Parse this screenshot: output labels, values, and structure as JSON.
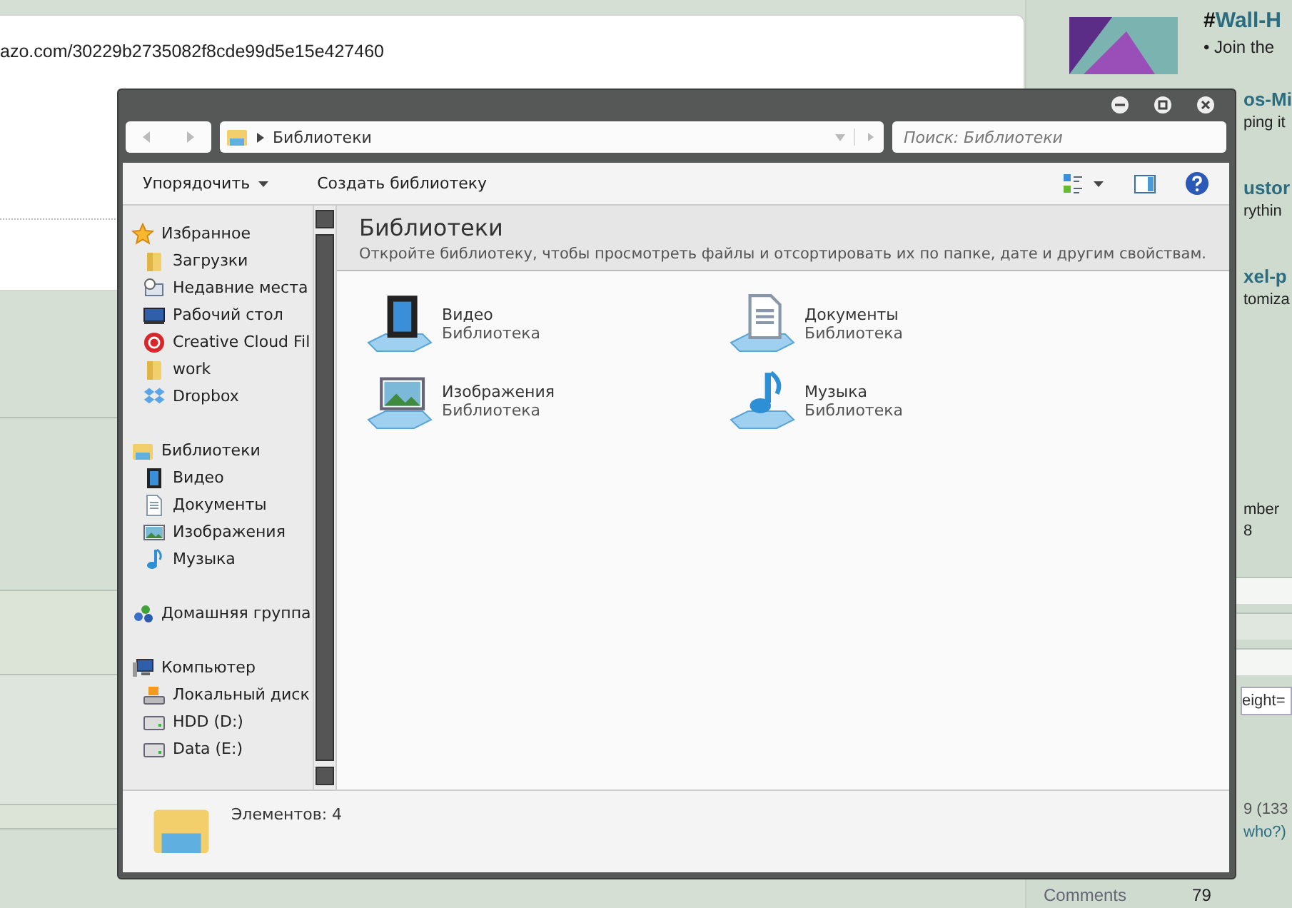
{
  "page": {
    "url_text": "azo.com/30229b2735082f8cde99d5e15e427460"
  },
  "sidebar": {
    "featured": {
      "prefix": "#",
      "title": "Wall-H",
      "text": "• Join the"
    },
    "snippets": [
      {
        "heading": "os-Mi",
        "text": "ping it"
      },
      {
        "heading": "ustor",
        "text": "rythin"
      },
      {
        "heading": "xel-p",
        "text": "tomiza"
      }
    ],
    "info": [
      "mber",
      "8"
    ],
    "field_value": "eight=",
    "stats": [
      "9 (133",
      "who?)"
    ],
    "footer": {
      "label": "Comments",
      "value": "79"
    }
  },
  "explorer": {
    "address": {
      "path": "Библиотеки"
    },
    "search": {
      "placeholder": "Поиск: Библиотеки"
    },
    "toolbar": [
      {
        "label": "Упорядочить",
        "dropdown": true
      },
      {
        "label": "Создать библиотеку",
        "dropdown": false
      }
    ],
    "nav": [
      {
        "label": "Избранное",
        "kind": "star",
        "children": [
          {
            "label": "Загрузки",
            "kind": "folder"
          },
          {
            "label": "Недавние места",
            "kind": "recent"
          },
          {
            "label": "Рабочий стол",
            "kind": "desktop"
          },
          {
            "label": "Creative Cloud Fil",
            "kind": "cloud"
          },
          {
            "label": "work",
            "kind": "folder"
          },
          {
            "label": "Dropbox",
            "kind": "dropbox"
          }
        ]
      },
      {
        "label": "Библиотеки",
        "kind": "library",
        "children": [
          {
            "label": "Видео",
            "kind": "video"
          },
          {
            "label": "Документы",
            "kind": "document"
          },
          {
            "label": "Изображения",
            "kind": "picture"
          },
          {
            "label": "Музыка",
            "kind": "music"
          }
        ]
      },
      {
        "label": "Домашняя группа",
        "kind": "homegroup"
      },
      {
        "label": "Компьютер",
        "kind": "computer",
        "children": [
          {
            "label": "Локальный диск",
            "kind": "sysdrive"
          },
          {
            "label": "HDD (D:)",
            "kind": "drive"
          },
          {
            "label": "Data (E:)",
            "kind": "drive"
          }
        ]
      }
    ],
    "content": {
      "title": "Библиотеки",
      "description": "Откройте библиотеку, чтобы просмотреть файлы и отсортировать их по папке, дате и другим свойствам.",
      "libraries": [
        {
          "name": "Видео",
          "type": "Библиотека",
          "kind": "video"
        },
        {
          "name": "Документы",
          "type": "Библиотека",
          "kind": "document"
        },
        {
          "name": "Изображения",
          "type": "Библиотека",
          "kind": "picture"
        },
        {
          "name": "Музыка",
          "type": "Библиотека",
          "kind": "music"
        }
      ]
    },
    "status": "Элементов: 4"
  }
}
